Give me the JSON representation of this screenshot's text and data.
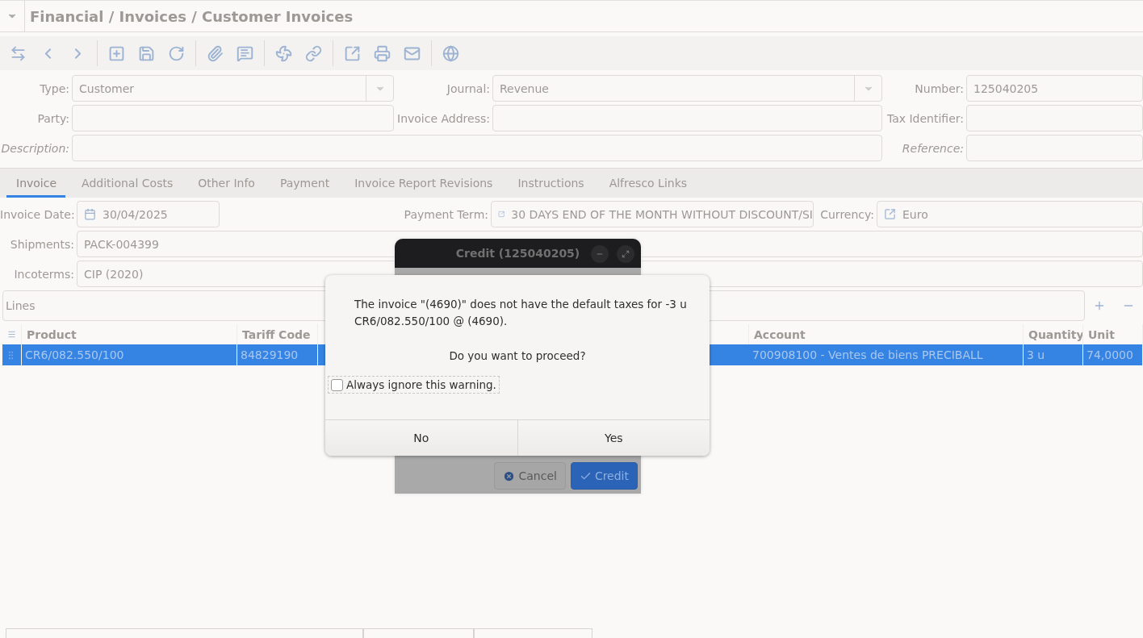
{
  "header": {
    "title": "Financial / Invoices / Customer Invoices"
  },
  "form": {
    "rows": [
      [
        {
          "label": "Type:",
          "kind": "select",
          "value": "Customer",
          "italic": false
        },
        {
          "label": "Journal:",
          "kind": "select",
          "value": "Revenue",
          "italic": false
        },
        {
          "label": "Number:",
          "kind": "text",
          "value": "125040205",
          "italic": false
        }
      ],
      [
        {
          "label": "Party:",
          "kind": "text",
          "italic": false
        },
        {
          "label": "Invoice Address:",
          "kind": "text",
          "italic": false
        },
        {
          "label": "Tax Identifier:",
          "kind": "text",
          "italic": false
        }
      ],
      [
        {
          "label": "Description:",
          "kind": "wide",
          "italic": true
        },
        "",
        {
          "label": "Reference:",
          "kind": "text",
          "italic": true
        }
      ]
    ]
  },
  "tabs": [
    {
      "label": "Invoice",
      "selected": true
    },
    {
      "label": "Additional Costs",
      "selected": false
    },
    {
      "label": "Other Info",
      "selected": false
    },
    {
      "label": "Payment",
      "selected": false
    },
    {
      "label": "Invoice Report Revisions",
      "selected": false
    },
    {
      "label": "Instructions",
      "selected": false
    },
    {
      "label": "Alfresco Links",
      "selected": false
    }
  ],
  "invoice": {
    "date": {
      "label": "Invoice Date:",
      "value": "30/04/2025"
    },
    "payment_term": {
      "label": "Payment Term:",
      "value": "30 DAYS END OF THE MONTH WITHOUT DISCOUNT/SI"
    },
    "currency": {
      "label": "Currency:",
      "value": "Euro"
    },
    "shipments": {
      "label": "Shipments:",
      "value": "PACK-004399"
    },
    "incoterms": {
      "label": "Incoterms:",
      "value": "CIP (2020)"
    }
  },
  "lines": {
    "title": "Lines",
    "columns": [
      {
        "label": "Product"
      },
      {
        "label": "Tariff Code"
      },
      {
        "label": "Account"
      },
      {
        "label": "Quantity"
      },
      {
        "label": "Unit"
      }
    ],
    "rows": [
      {
        "selected": true,
        "cells": [
          "CR6/082.550/100",
          "84829190",
          "700908100 - Ventes de biens PRECIBALL",
          "3 u",
          "74,0000"
        ]
      }
    ]
  },
  "wizard": {
    "title": "Credit (125040205)",
    "buttons": [
      {
        "label": "Cancel",
        "kind": "cancel"
      },
      {
        "label": "Credit",
        "kind": "primary"
      }
    ]
  },
  "alert": {
    "message": "The invoice \"(4690)\" does not have the default taxes for -3 u CR6/082.550/100 @ (4690).",
    "question": "Do you want to proceed?",
    "checkbox": {
      "label": "Always ignore this warning.",
      "checked": false
    },
    "buttons": [
      "No",
      "Yes"
    ]
  }
}
